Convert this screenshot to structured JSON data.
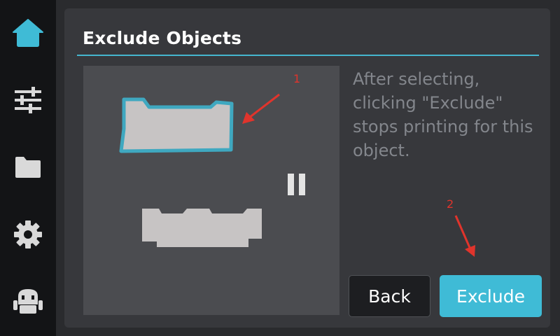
{
  "sidebar": {
    "items": [
      {
        "name": "home",
        "icon": "home-icon",
        "active": true
      },
      {
        "name": "controls",
        "icon": "sliders-icon",
        "active": false
      },
      {
        "name": "files",
        "icon": "folder-icon",
        "active": false
      },
      {
        "name": "settings",
        "icon": "gear-icon",
        "active": false
      },
      {
        "name": "robot",
        "icon": "robot-icon",
        "active": false
      }
    ]
  },
  "dialog": {
    "title": "Exclude Objects",
    "description": "After selecting, clicking \"Exclude\" stops printing for this object.",
    "back_label": "Back",
    "exclude_label": "Exclude"
  },
  "annotations": {
    "marker_1": "1",
    "marker_2": "2"
  },
  "colors": {
    "accent": "#3fbbd6",
    "annotation": "#e0342c",
    "panel": "#37383c",
    "sidebar": "#131416"
  }
}
